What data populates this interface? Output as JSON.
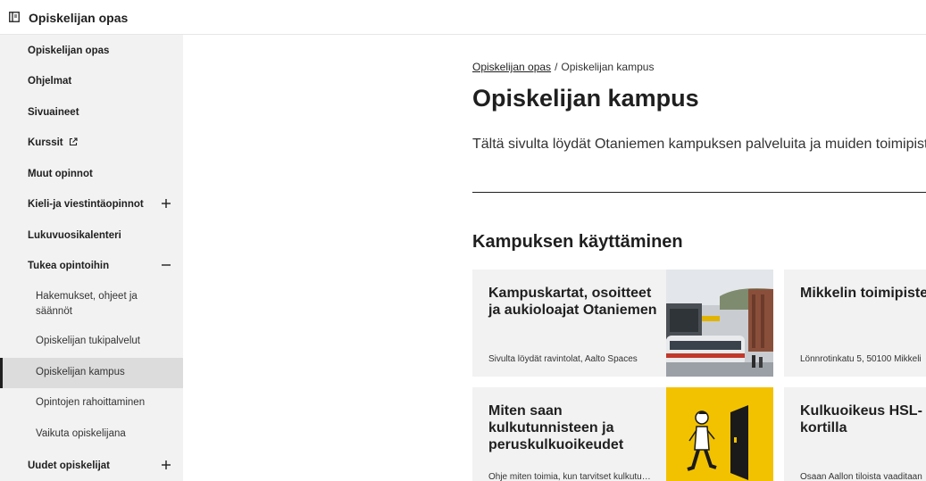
{
  "header": {
    "title": "Opiskelijan opas",
    "panel_icon": "sidebar-panel-icon"
  },
  "sidebar": {
    "items": [
      {
        "label": "Opiskelijan opas"
      },
      {
        "label": "Ohjelmat"
      },
      {
        "label": "Sivuaineet"
      },
      {
        "label": "Kurssit",
        "icon": "external-link-icon"
      },
      {
        "label": "Muut opinnot"
      },
      {
        "label": "Kieli-ja viestintäopinnot",
        "toggle": "plus-icon"
      },
      {
        "label": "Lukuvuosikalenteri"
      },
      {
        "label": "Tukea opintoihin",
        "toggle": "minus-icon"
      },
      {
        "label": "Uudet opiskelijat",
        "toggle": "plus-icon"
      }
    ],
    "subitems": [
      {
        "label": "Hakemukset, ohjeet ja säännöt"
      },
      {
        "label": "Opiskelijan tukipalvelut"
      },
      {
        "label": "Opiskelijan kampus",
        "active": true
      },
      {
        "label": "Opintojen rahoittaminen"
      },
      {
        "label": "Vaikuta opiskelijana"
      }
    ]
  },
  "breadcrumb": {
    "parent": "Opiskelijan opas",
    "separator": "/",
    "current": "Opiskelijan kampus"
  },
  "page": {
    "title": "Opiskelijan kampus",
    "intro": "Tältä sivulta löydät Otaniemen kampuksen palveluita ja muiden toimipisteiden",
    "section_title": "Kampuksen käyttäminen"
  },
  "cards": [
    {
      "title": "Kampuskartat, osoitteet ja aukioloajat Otaniemen",
      "desc": "Sivulta löydät ravintolat, Aalto Spaces",
      "image": "campus-tram-photo"
    },
    {
      "title": "Mikkelin toimipiste",
      "desc": "Lönnrotinkatu 5, 50100 Mikkeli"
    },
    {
      "title": "Miten saan kulkutunnisteen ja peruskulkuoikeudet",
      "desc": "Ohje miten toimia, kun tarvitset kulkutunnisteen",
      "image": "person-door-illustration"
    },
    {
      "title": "Kulkuoikeus HSL-kortilla",
      "desc": "Osaan Aallon tiloista vaaditaan"
    }
  ],
  "colors": {
    "sidebar_bg": "#f2f2f2",
    "active_bg": "#dcdcdc",
    "card_bg": "#f2f2f2",
    "illustration_yellow": "#f2c200",
    "text": "#1f1f1f"
  }
}
